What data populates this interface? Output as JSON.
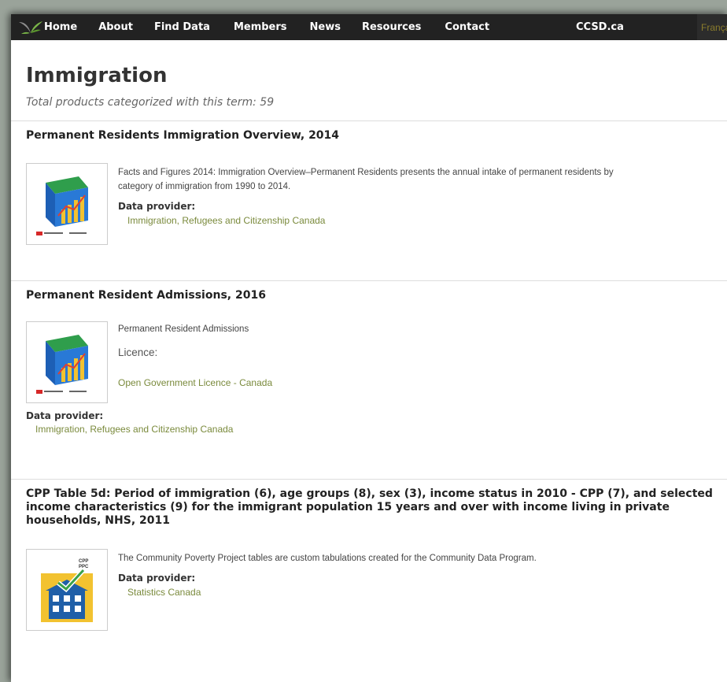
{
  "nav": {
    "items": [
      "Home",
      "About",
      "Find Data",
      "Members",
      "News",
      "Resources",
      "Contact"
    ],
    "site": "CCSD.ca",
    "language": "Français"
  },
  "page": {
    "title": "Immigration",
    "subtitle": "Total products categorized with this term: 59"
  },
  "products": [
    {
      "title": "Permanent Residents Immigration Overview, 2014",
      "description": "Facts and Figures 2014: Immigration Overview–Permanent Residents presents the annual intake of permanent residents by category of immigration from 1990 to 2014.",
      "provider_label": "Data provider:",
      "provider": "Immigration, Refugees and Citizenship Canada"
    },
    {
      "title": "Permanent Resident Admissions, 2016",
      "description": "Permanent Resident Admissions",
      "licence_label": "Licence:",
      "licence": "Open Government Licence - Canada",
      "provider_label": "Data provider:",
      "provider": "Immigration, Refugees and Citizenship Canada"
    },
    {
      "title": "CPP Table 5d: Period of immigration (6), age groups (8), sex (3), income status in 2010 - CPP (7), and selected income characteristics (9) for the immigrant population 15 years and over with income living in private households, NHS, 2011",
      "description": "The Community Poverty Project tables are custom tabulations created for the Community Data Program.",
      "provider_label": "Data provider:",
      "provider": "Statistics Canada",
      "thumb_badge": [
        "CPP",
        "PPC"
      ]
    }
  ],
  "colors": {
    "navbar": "#222222",
    "link": "#7a8a3c",
    "logo_green": "#7ab648",
    "logo_grey": "#8d8d8d"
  },
  "icons": {
    "logo": "leaf-logo-icon",
    "thumb_ircc": "data-cube-thumbnail",
    "thumb_cpp": "building-checkmark-thumbnail"
  }
}
